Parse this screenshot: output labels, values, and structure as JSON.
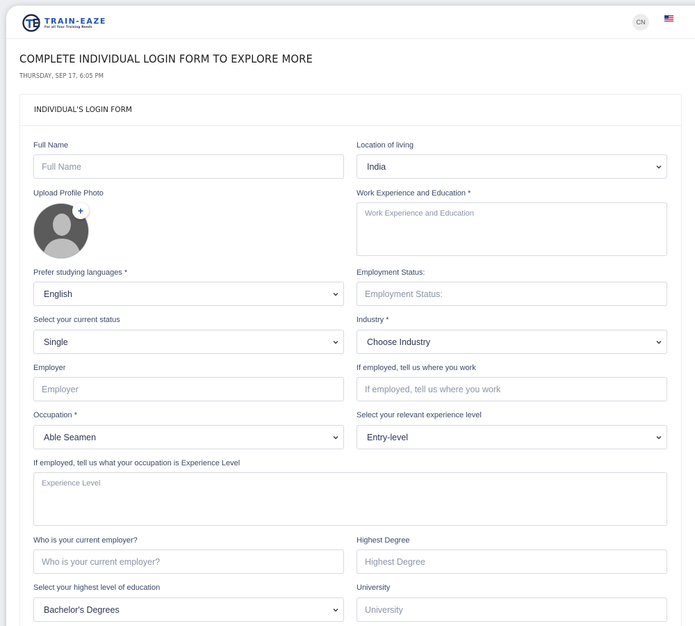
{
  "brand": {
    "name": "TRAIN-EAZE",
    "tagline": "For all Your Training Needs",
    "accent": "#1f54b0"
  },
  "header": {
    "lang_badge": "CN",
    "flag_icon": "us-flag-icon"
  },
  "page": {
    "title": "COMPLETE INDIVIDUAL LOGIN FORM TO EXPLORE MORE",
    "date": "THURSDAY, SEP 17, 6:05 PM"
  },
  "card": {
    "title": "INDIVIDUAL'S LOGIN FORM"
  },
  "form": {
    "full_name": {
      "label": "Full Name",
      "placeholder": "Full Name"
    },
    "location": {
      "label": "Location of living",
      "value": "India"
    },
    "photo": {
      "label": "Upload Profile Photo",
      "add": "+"
    },
    "work_exp": {
      "label": "Work Experience and Education *",
      "placeholder": "Work Experience and Education"
    },
    "languages": {
      "label": "Prefer studying languages *",
      "value": "English"
    },
    "employment_status": {
      "label": "Employment Status:",
      "placeholder": "Employment Status:"
    },
    "current_status": {
      "label": "Select your current status",
      "value": "Single"
    },
    "industry": {
      "label": "Industry *",
      "value": "Choose Industry"
    },
    "employer": {
      "label": "Employer",
      "placeholder": "Employer"
    },
    "work_where": {
      "label": "If employed, tell us where you work",
      "placeholder": "If employed, tell us where you work"
    },
    "occupation": {
      "label": "Occupation *",
      "value": "Able Seamen"
    },
    "experience_level": {
      "label": "Select your relevant experience level",
      "value": "Entry-level"
    },
    "occupation_exp": {
      "label": "If employed, tell us what your occupation is Experience Level",
      "placeholder": "Experience Level"
    },
    "current_employer": {
      "label": "Who is your current employer?",
      "placeholder": "Who is your current employer?"
    },
    "highest_degree": {
      "label": "Highest Degree",
      "placeholder": "Highest Degree"
    },
    "education_level": {
      "label": "Select your highest level of education",
      "value": "Bachelor's Degrees"
    },
    "university": {
      "label": "University",
      "placeholder": "University"
    }
  }
}
